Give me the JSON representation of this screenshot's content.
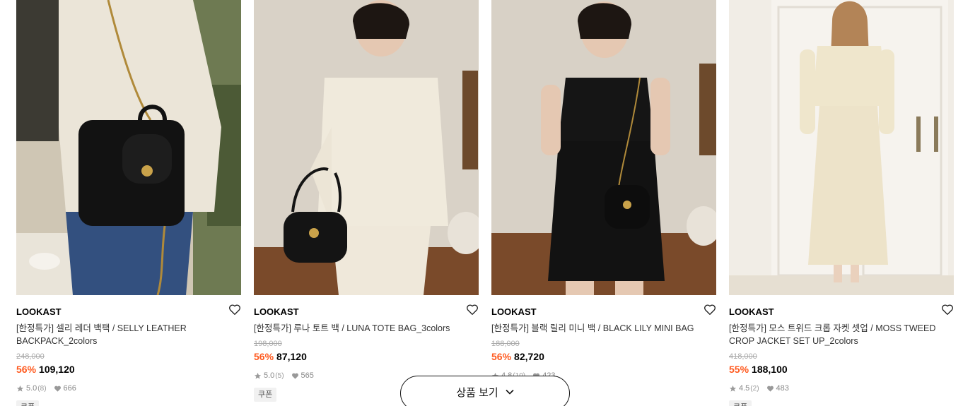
{
  "products": [
    {
      "brand": "LOOKAST",
      "name": "[한정특가] 셀리 레더 백팩 / SELLY LEATHER BACKPACK_2colors",
      "original_price": "248,000",
      "discount": "56%",
      "price": "109,120",
      "rating": "5.0",
      "reviews": "(8)",
      "likes": "666",
      "badge": "쿠폰",
      "image_icon": "backpack-product-photo"
    },
    {
      "brand": "LOOKAST",
      "name": "[한정특가] 루나 토트 백 / LUNA TOTE BAG_3colors",
      "original_price": "198,000",
      "discount": "56%",
      "price": "87,120",
      "rating": "5.0",
      "reviews": "(5)",
      "likes": "565",
      "badge": "쿠폰",
      "image_icon": "tote-bag-product-photo"
    },
    {
      "brand": "LOOKAST",
      "name": "[한정특가] 블랙 릴리 미니 백 / BLACK LILY MINI BAG",
      "original_price": "188,000",
      "discount": "56%",
      "price": "82,720",
      "rating": "4.8",
      "reviews": "(10)",
      "likes": "423",
      "badge": "",
      "image_icon": "mini-bag-product-photo"
    },
    {
      "brand": "LOOKAST",
      "name": "[한정특가] 모스 트위드 크롭 자켓 셋업 / MOSS TWEED CROP JACKET SET UP_2colors",
      "original_price": "418,000",
      "discount": "55%",
      "price": "188,100",
      "rating": "4.5",
      "reviews": "(2)",
      "likes": "483",
      "badge": "쿠폰",
      "image_icon": "tweed-jacket-product-photo"
    }
  ],
  "more_button": {
    "label": "상품 보기",
    "icon": "chevron-down-icon"
  },
  "colors": {
    "discount": "#ff5a1f",
    "text": "#000000",
    "muted": "#888888"
  }
}
